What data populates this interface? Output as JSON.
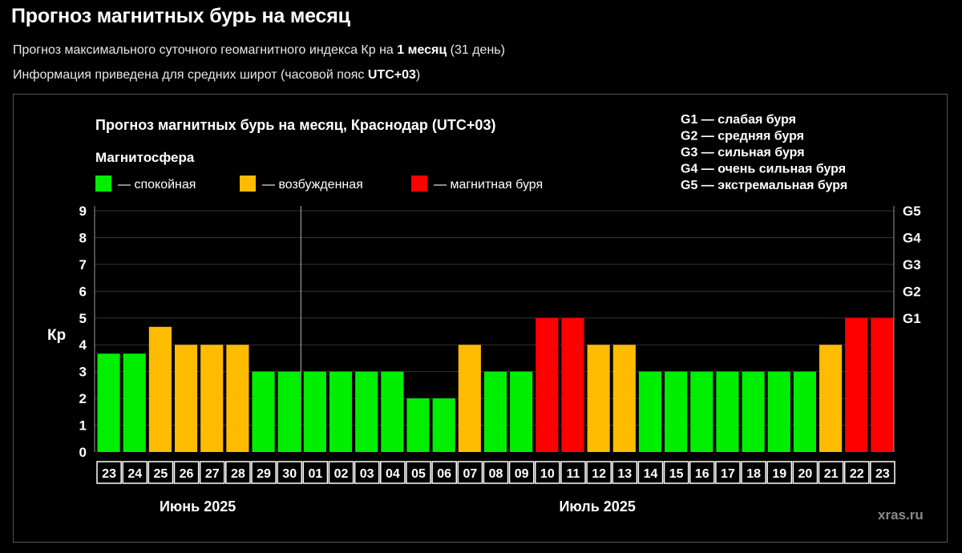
{
  "header": {
    "title": "Прогноз магнитных бурь на месяц",
    "subtitle1_prefix": "Прогноз максимального суточного геомагнитного индекса Кр на ",
    "subtitle1_bold": "1 месяц",
    "subtitle1_suffix": " (31 день)",
    "subtitle2_prefix": "Информация приведена для средних широт (часовой пояс ",
    "subtitle2_bold": "UTC+03",
    "subtitle2_suffix": ")"
  },
  "colors": {
    "calm": "#00ee00",
    "excited": "#ffbb00",
    "storm": "#ff0000",
    "background": "#000000",
    "grid": "#333333"
  },
  "chart_data": {
    "type": "bar",
    "title": "Прогноз магнитных бурь на месяц, Краснодар (UTC+03)",
    "ylabel": "Кр",
    "ylim": [
      0,
      9
    ],
    "yticks": [
      0,
      1,
      2,
      3,
      4,
      5,
      6,
      7,
      8,
      9
    ],
    "right_axis_labels": [
      {
        "value": 5,
        "label": "G1"
      },
      {
        "value": 6,
        "label": "G2"
      },
      {
        "value": 7,
        "label": "G3"
      },
      {
        "value": 8,
        "label": "G4"
      },
      {
        "value": 9,
        "label": "G5"
      }
    ],
    "legend_title": "Магнитосфера",
    "legend": [
      {
        "key": "calm",
        "label": "— спокойная"
      },
      {
        "key": "excited",
        "label": "— возбужденная"
      },
      {
        "key": "storm",
        "label": "— магнитная буря"
      }
    ],
    "storm_legend": [
      "G1 — слабая буря",
      "G2 — средняя буря",
      "G3 — сильная буря",
      "G4 — очень сильная буря",
      "G5 — экстремальная буря"
    ],
    "months": [
      {
        "label": "Июнь 2025",
        "from": 0,
        "to": 7
      },
      {
        "label": "Июль 2025",
        "from": 8,
        "to": 30
      }
    ],
    "categories": [
      "23",
      "24",
      "25",
      "26",
      "27",
      "28",
      "29",
      "30",
      "01",
      "02",
      "03",
      "04",
      "05",
      "06",
      "07",
      "08",
      "09",
      "10",
      "11",
      "12",
      "13",
      "14",
      "15",
      "16",
      "17",
      "18",
      "19",
      "20",
      "21",
      "22",
      "23"
    ],
    "values": [
      3.67,
      3.67,
      4.67,
      4,
      4,
      4,
      3,
      3,
      3,
      3,
      3,
      3,
      2,
      2,
      4,
      3,
      3,
      5,
      5,
      4,
      4,
      3,
      3,
      3,
      3,
      3,
      3,
      3,
      4,
      5,
      5
    ],
    "status": [
      "calm",
      "calm",
      "excited",
      "excited",
      "excited",
      "excited",
      "calm",
      "calm",
      "calm",
      "calm",
      "calm",
      "calm",
      "calm",
      "calm",
      "excited",
      "calm",
      "calm",
      "storm",
      "storm",
      "excited",
      "excited",
      "calm",
      "calm",
      "calm",
      "calm",
      "calm",
      "calm",
      "calm",
      "excited",
      "storm",
      "storm"
    ],
    "watermark": "xras.ru"
  }
}
